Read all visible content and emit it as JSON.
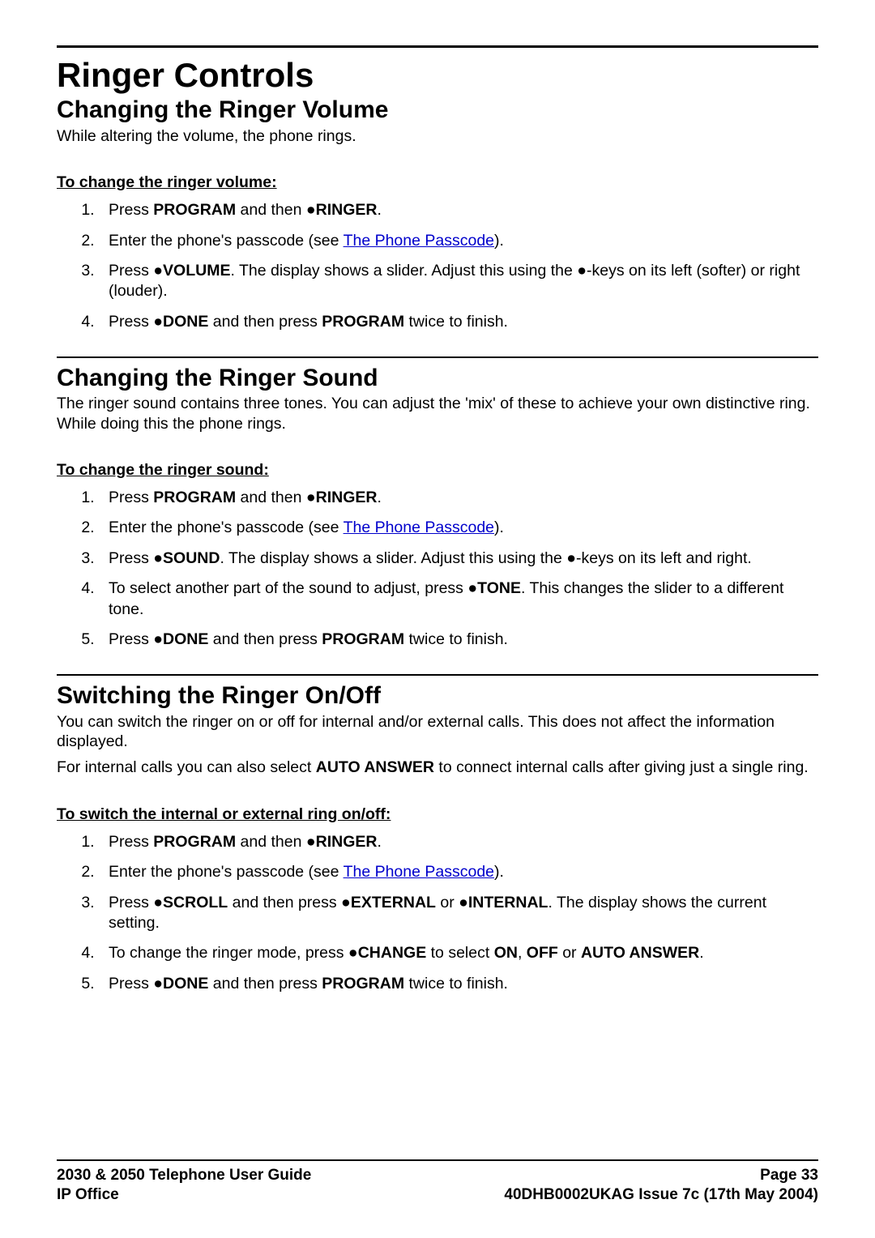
{
  "title": "Ringer Controls",
  "sections": {
    "s1": {
      "heading": "Changing the Ringer Volume",
      "intro": "While altering the volume, the phone rings.",
      "subheading": "To change the ringer volume:",
      "steps": {
        "n1a": "Press ",
        "n1b": "PROGRAM",
        "n1c": " and then ●",
        "n1d": "RINGER",
        "n1e": ".",
        "n2a": "Enter the phone's passcode (see ",
        "n2link": "The Phone Passcode",
        "n2c": ").",
        "n3a": "Press ●",
        "n3b": "VOLUME",
        "n3c": ". The display shows a slider. Adjust this using the ●-keys on its left (softer) or right (louder).",
        "n4a": "Press ●",
        "n4b": "DONE",
        "n4c": " and then press ",
        "n4d": "PROGRAM",
        "n4e": " twice to finish."
      }
    },
    "s2": {
      "heading": "Changing the Ringer Sound",
      "intro": "The ringer sound contains three tones. You can adjust the 'mix' of these to achieve your own distinctive ring. While doing this the phone rings.",
      "subheading": "To change the ringer sound:",
      "steps": {
        "n1a": "Press ",
        "n1b": "PROGRAM",
        "n1c": " and then ●",
        "n1d": "RINGER",
        "n1e": ".",
        "n2a": "Enter the phone's passcode (see ",
        "n2link": "The Phone Passcode",
        "n2c": ").",
        "n3a": "Press ●",
        "n3b": "SOUND",
        "n3c": ". The display shows a slider. Adjust this using the ●-keys on its left and right.",
        "n4a": "To select another part of the sound to adjust, press ●",
        "n4b": "TONE",
        "n4c": ". This changes the slider to a different tone.",
        "n5a": "Press ●",
        "n5b": "DONE",
        "n5c": " and then press ",
        "n5d": "PROGRAM",
        "n5e": " twice to finish."
      }
    },
    "s3": {
      "heading": "Switching the Ringer On/Off",
      "intro1a": "You can switch the ringer on or off for internal and/or external calls. This does not affect the information displayed.",
      "intro2a": "For internal calls you can also select ",
      "intro2b": "AUTO ANSWER",
      "intro2c": " to connect internal calls after giving just a single ring.",
      "subheading": "To switch the internal or external ring on/off:",
      "steps": {
        "n1a": "Press ",
        "n1b": "PROGRAM",
        "n1c": " and then ●",
        "n1d": "RINGER",
        "n1e": ".",
        "n2a": "Enter the phone's passcode (see ",
        "n2link": "The Phone Passcode",
        "n2c": ").",
        "n3a": "Press ●",
        "n3b": "SCROLL",
        "n3c": " and then press ●",
        "n3d": "EXTERNAL",
        "n3e": " or ●",
        "n3f": "INTERNAL",
        "n3g": ". The display shows the current setting.",
        "n4a": "To change the ringer mode, press ●",
        "n4b": "CHANGE",
        "n4c": " to select ",
        "n4d": "ON",
        "n4e": ", ",
        "n4f": "OFF",
        "n4g": " or ",
        "n4h": "AUTO ANSWER",
        "n4i": ".",
        "n5a": "Press ●",
        "n5b": "DONE",
        "n5c": " and then press ",
        "n5d": "PROGRAM",
        "n5e": " twice to finish."
      }
    }
  },
  "footer": {
    "left1": "2030 & 2050 Telephone User Guide",
    "left2": "IP Office",
    "right1": "Page 33",
    "right2": "40DHB0002UKAG Issue 7c (17th May 2004)"
  }
}
